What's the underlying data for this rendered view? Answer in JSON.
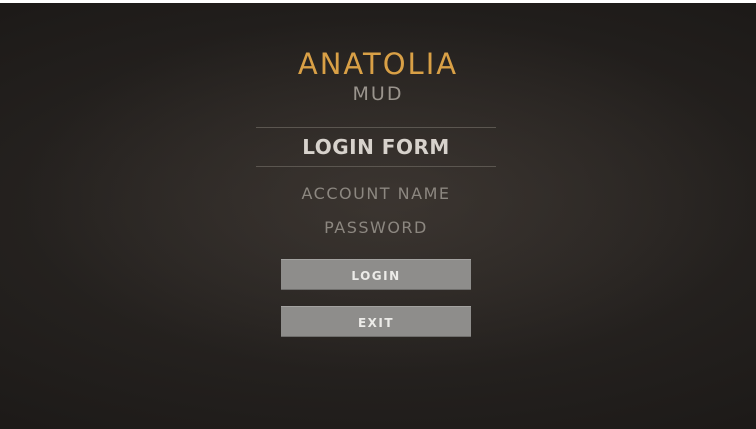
{
  "logo": {
    "title": "ANATOLIA",
    "subtitle": "MUD"
  },
  "form": {
    "title": "LOGIN FORM",
    "account_name_label": "ACCOUNT NAME",
    "password_label": "PASSWORD"
  },
  "buttons": {
    "login_label": "LOGIN",
    "exit_label": "EXIT"
  },
  "colors": {
    "brand_gold": "#d9a046",
    "background": "#1f1c1a",
    "button_fill": "#8e8d8b"
  }
}
